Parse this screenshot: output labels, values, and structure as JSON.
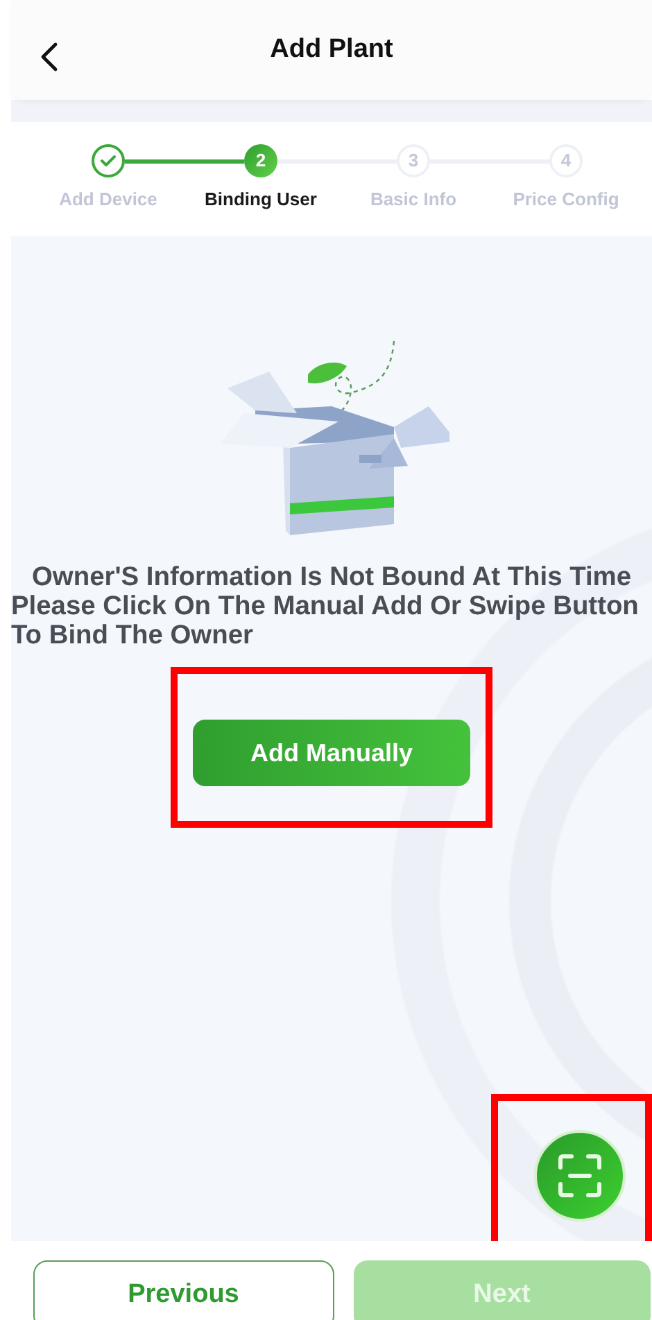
{
  "header": {
    "title": "Add Plant"
  },
  "steps": [
    {
      "label": "Add Device",
      "done": true,
      "selected": false
    },
    {
      "label": "Binding User",
      "number": "2",
      "done": false,
      "selected": true
    },
    {
      "label": "Basic Info",
      "number": "3",
      "done": false,
      "selected": false
    },
    {
      "label": "Price Config",
      "number": "4",
      "done": false,
      "selected": false
    }
  ],
  "empty_state": {
    "message_lines": [
      "Owner'S Information Is Not Bound At This Time",
      "Please Click On The Manual Add Or Swipe Button",
      "To Bind The Owner"
    ]
  },
  "add_button": {
    "label": "Add Manually",
    "highlighted": true
  },
  "scan_button": {
    "highlighted": true
  },
  "footer": {
    "previous": {
      "label": "Previous",
      "disabled": false
    },
    "next": {
      "label": "Next",
      "disabled": true
    }
  }
}
